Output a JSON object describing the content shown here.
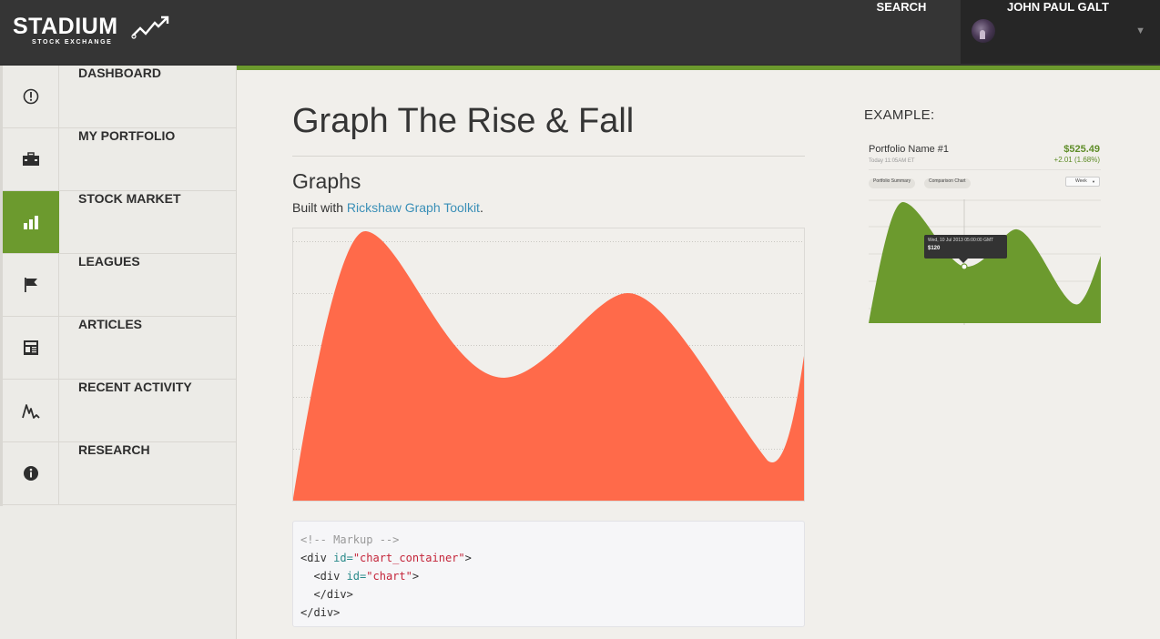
{
  "brand": {
    "name": "STADIUM",
    "tagline": "STOCK EXCHANGE"
  },
  "header": {
    "search_label": "SEARCH",
    "user_name": "JOHN PAUL GALT",
    "caret": "▼"
  },
  "sidebar": {
    "items": [
      {
        "label": "DASHBOARD",
        "icon": "dashboard-icon",
        "active": false
      },
      {
        "label": "MY PORTFOLIO",
        "icon": "briefcase-icon",
        "active": false
      },
      {
        "label": "STOCK MARKET",
        "icon": "bar-chart-icon",
        "active": true
      },
      {
        "label": "LEAGUES",
        "icon": "flag-icon",
        "active": false
      },
      {
        "label": "ARTICLES",
        "icon": "newspaper-icon",
        "active": false
      },
      {
        "label": "RECENT ACTIVITY",
        "icon": "activity-icon",
        "active": false
      },
      {
        "label": "RESEARCH",
        "icon": "info-icon",
        "active": false
      }
    ]
  },
  "main": {
    "title": "Graph The Rise & Fall",
    "section_title": "Graphs",
    "built_prefix": "Built with ",
    "built_link": "Rickshaw Graph Toolkit",
    "built_suffix": ".",
    "code": {
      "comment": "<!-- Markup -->",
      "line2_tag_open": "<div ",
      "line2_attr": "id=",
      "line2_value": "\"chart_container\"",
      "line2_close": ">",
      "line3_tag_open": "  <div ",
      "line3_attr": "id=",
      "line3_value": "\"chart\"",
      "line3_close": ">",
      "line4": "  </div>",
      "line5": "</div>"
    }
  },
  "example": {
    "label": "EXAMPLE:",
    "portfolio_name": "Portfolio Name #1",
    "date": "Today 11:05AM ET",
    "value": "$525.49",
    "change": "+2.01 (1.68%)",
    "tabs": [
      "Portfolio Summary",
      "Comparison Chart"
    ],
    "select_value": "Week",
    "tooltip_date": "Wed, 10 Jul 2013 05:00:00 GMT",
    "tooltip_value": "$120"
  },
  "colors": {
    "accent": "#6c9a2e",
    "main_area_fill": "#ff6a4a",
    "example_area_fill": "#6c9a2e",
    "link": "#3a8fb7"
  }
}
